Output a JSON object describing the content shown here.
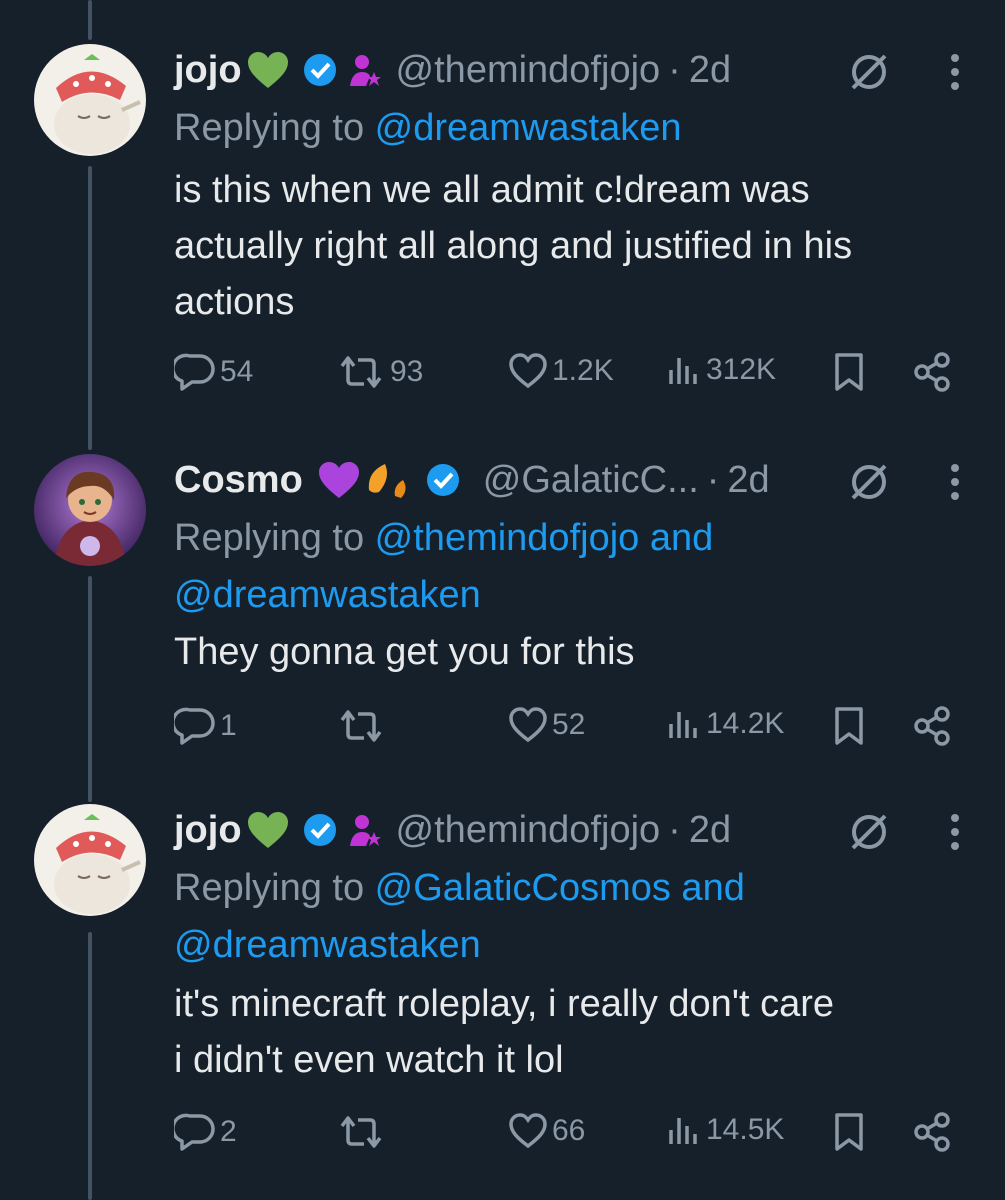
{
  "colors": {
    "background": "#15202b",
    "text": "#e7e9ea",
    "muted": "#8b98a5",
    "link": "#1d9bf0",
    "verified": "#1d9bf0",
    "affiliate": "#c233d6"
  },
  "tweets": [
    {
      "name": "jojo",
      "name_emoji": "green-heart",
      "handle": "@themindofjojo",
      "sep": "·",
      "time": "2d",
      "reply_prefix": "Replying to ",
      "reply_targets": "@dreamwastaken",
      "text": "is this when we all admit c!dream was\nactually right all along and justified in his\nactions",
      "stats": {
        "replies": "54",
        "reposts": "93",
        "likes": "1.2K",
        "views": "312K"
      }
    },
    {
      "name": "Cosmo",
      "name_emoji": "purple-heart-leaf",
      "handle": "@GalaticC...",
      "sep": "·",
      "time": "2d",
      "reply_prefix": "Replying to ",
      "reply_targets": "@themindofjojo and\n@dreamwastaken",
      "text": "They gonna get you for this",
      "stats": {
        "replies": "1",
        "reposts": "",
        "likes": "52",
        "views": "14.2K"
      }
    },
    {
      "name": "jojo",
      "name_emoji": "green-heart",
      "handle": "@themindofjojo",
      "sep": "·",
      "time": "2d",
      "reply_prefix": "Replying to ",
      "reply_targets": "@GalaticCosmos and\n@dreamwastaken",
      "text": "it's minecraft roleplay, i really don't care\ni didn't even watch it lol",
      "stats": {
        "replies": "2",
        "reposts": "",
        "likes": "66",
        "views": "14.5K"
      }
    }
  ]
}
